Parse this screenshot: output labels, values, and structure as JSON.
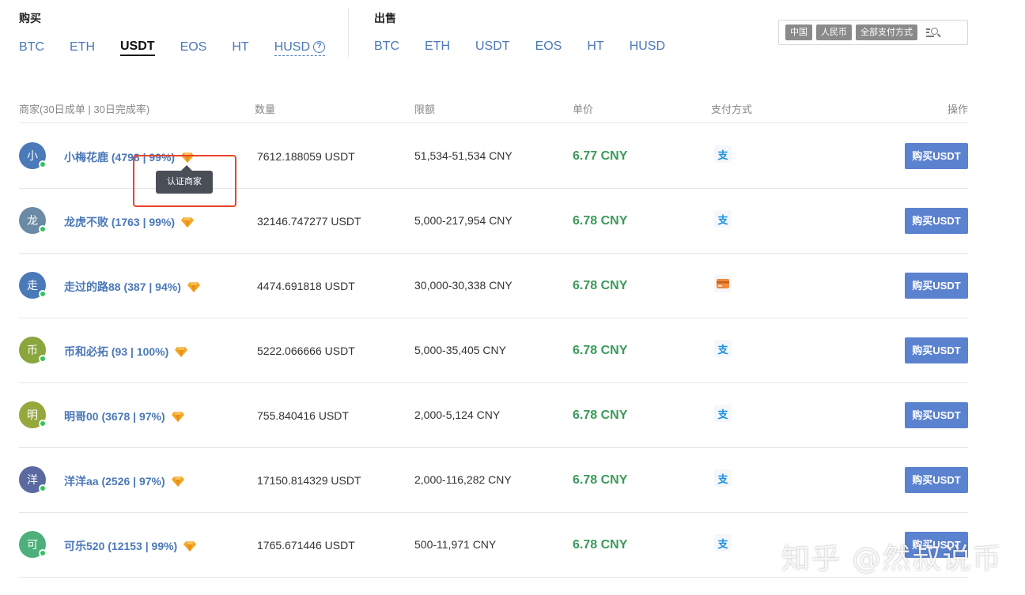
{
  "buy": {
    "title": "购买",
    "coins": [
      "BTC",
      "ETH",
      "USDT",
      "EOS",
      "HT",
      "HUSD"
    ],
    "active_coin": "USDT",
    "help_symbol": "?"
  },
  "sell": {
    "title": "出售",
    "coins": [
      "BTC",
      "ETH",
      "USDT",
      "EOS",
      "HT",
      "HUSD"
    ]
  },
  "filters": {
    "country": "中国",
    "currency": "人民币",
    "payment": "全部支付方式"
  },
  "table": {
    "headers": {
      "merchant": "商家(30日成单 | 30日完成率)",
      "amount": "数量",
      "limit": "限额",
      "price": "单价",
      "payment": "支付方式",
      "action": "操作"
    },
    "rows": [
      {
        "avatar": "小",
        "avatar_color": "#4a7ab8",
        "name": "小梅花鹿 (4798 | 99%)",
        "amount": "7612.188059 USDT",
        "limit": "51,534-51,534 CNY",
        "price": "6.77 CNY",
        "pay_type": "alipay-icon",
        "pay_glyph": "支",
        "button": "购买USDT"
      },
      {
        "avatar": "龙",
        "avatar_color": "#6b8aa5",
        "name": "龙虎不败 (1763 | 99%)",
        "amount": "32146.747277 USDT",
        "limit": "5,000-217,954 CNY",
        "price": "6.78 CNY",
        "pay_type": "alipay-icon",
        "pay_glyph": "支",
        "button": "购买USDT"
      },
      {
        "avatar": "走",
        "avatar_color": "#4a7ab8",
        "name": "走过的路88 (387 | 94%)",
        "amount": "4474.691818 USDT",
        "limit": "30,000-30,338 CNY",
        "price": "6.78 CNY",
        "pay_type": "bank-card-icon",
        "pay_glyph": "",
        "button": "购买USDT"
      },
      {
        "avatar": "币",
        "avatar_color": "#8aa63c",
        "name": "币和必拓 (93 | 100%)",
        "amount": "5222.066666 USDT",
        "limit": "5,000-35,405 CNY",
        "price": "6.78 CNY",
        "pay_type": "alipay-icon",
        "pay_glyph": "支",
        "button": "购买USDT"
      },
      {
        "avatar": "明",
        "avatar_color": "#94a83c",
        "name": "明哥00 (3678 | 97%)",
        "amount": "755.840416 USDT",
        "limit": "2,000-5,124 CNY",
        "price": "6.78 CNY",
        "pay_type": "alipay-icon",
        "pay_glyph": "支",
        "button": "购买USDT"
      },
      {
        "avatar": "洋",
        "avatar_color": "#5a6aa0",
        "name": "洋洋aa (2526 | 97%)",
        "amount": "17150.814329 USDT",
        "limit": "2,000-116,282 CNY",
        "price": "6.78 CNY",
        "pay_type": "alipay-icon",
        "pay_glyph": "支",
        "button": "购买USDT"
      },
      {
        "avatar": "可",
        "avatar_color": "#4db07a",
        "name": "可乐520 (12153 | 99%)",
        "amount": "1765.671446 USDT",
        "limit": "500-11,971 CNY",
        "price": "6.78 CNY",
        "pay_type": "alipay-icon",
        "pay_glyph": "支",
        "button": "购买USDT"
      }
    ]
  },
  "tooltip": "认证商家",
  "watermark": "知乎 @然叔说币",
  "colors": {
    "link": "#4a78b8",
    "price": "#3a9a5a",
    "button": "#5b82cf",
    "highlight": "#e8452b",
    "diamond": "#f5a623"
  }
}
